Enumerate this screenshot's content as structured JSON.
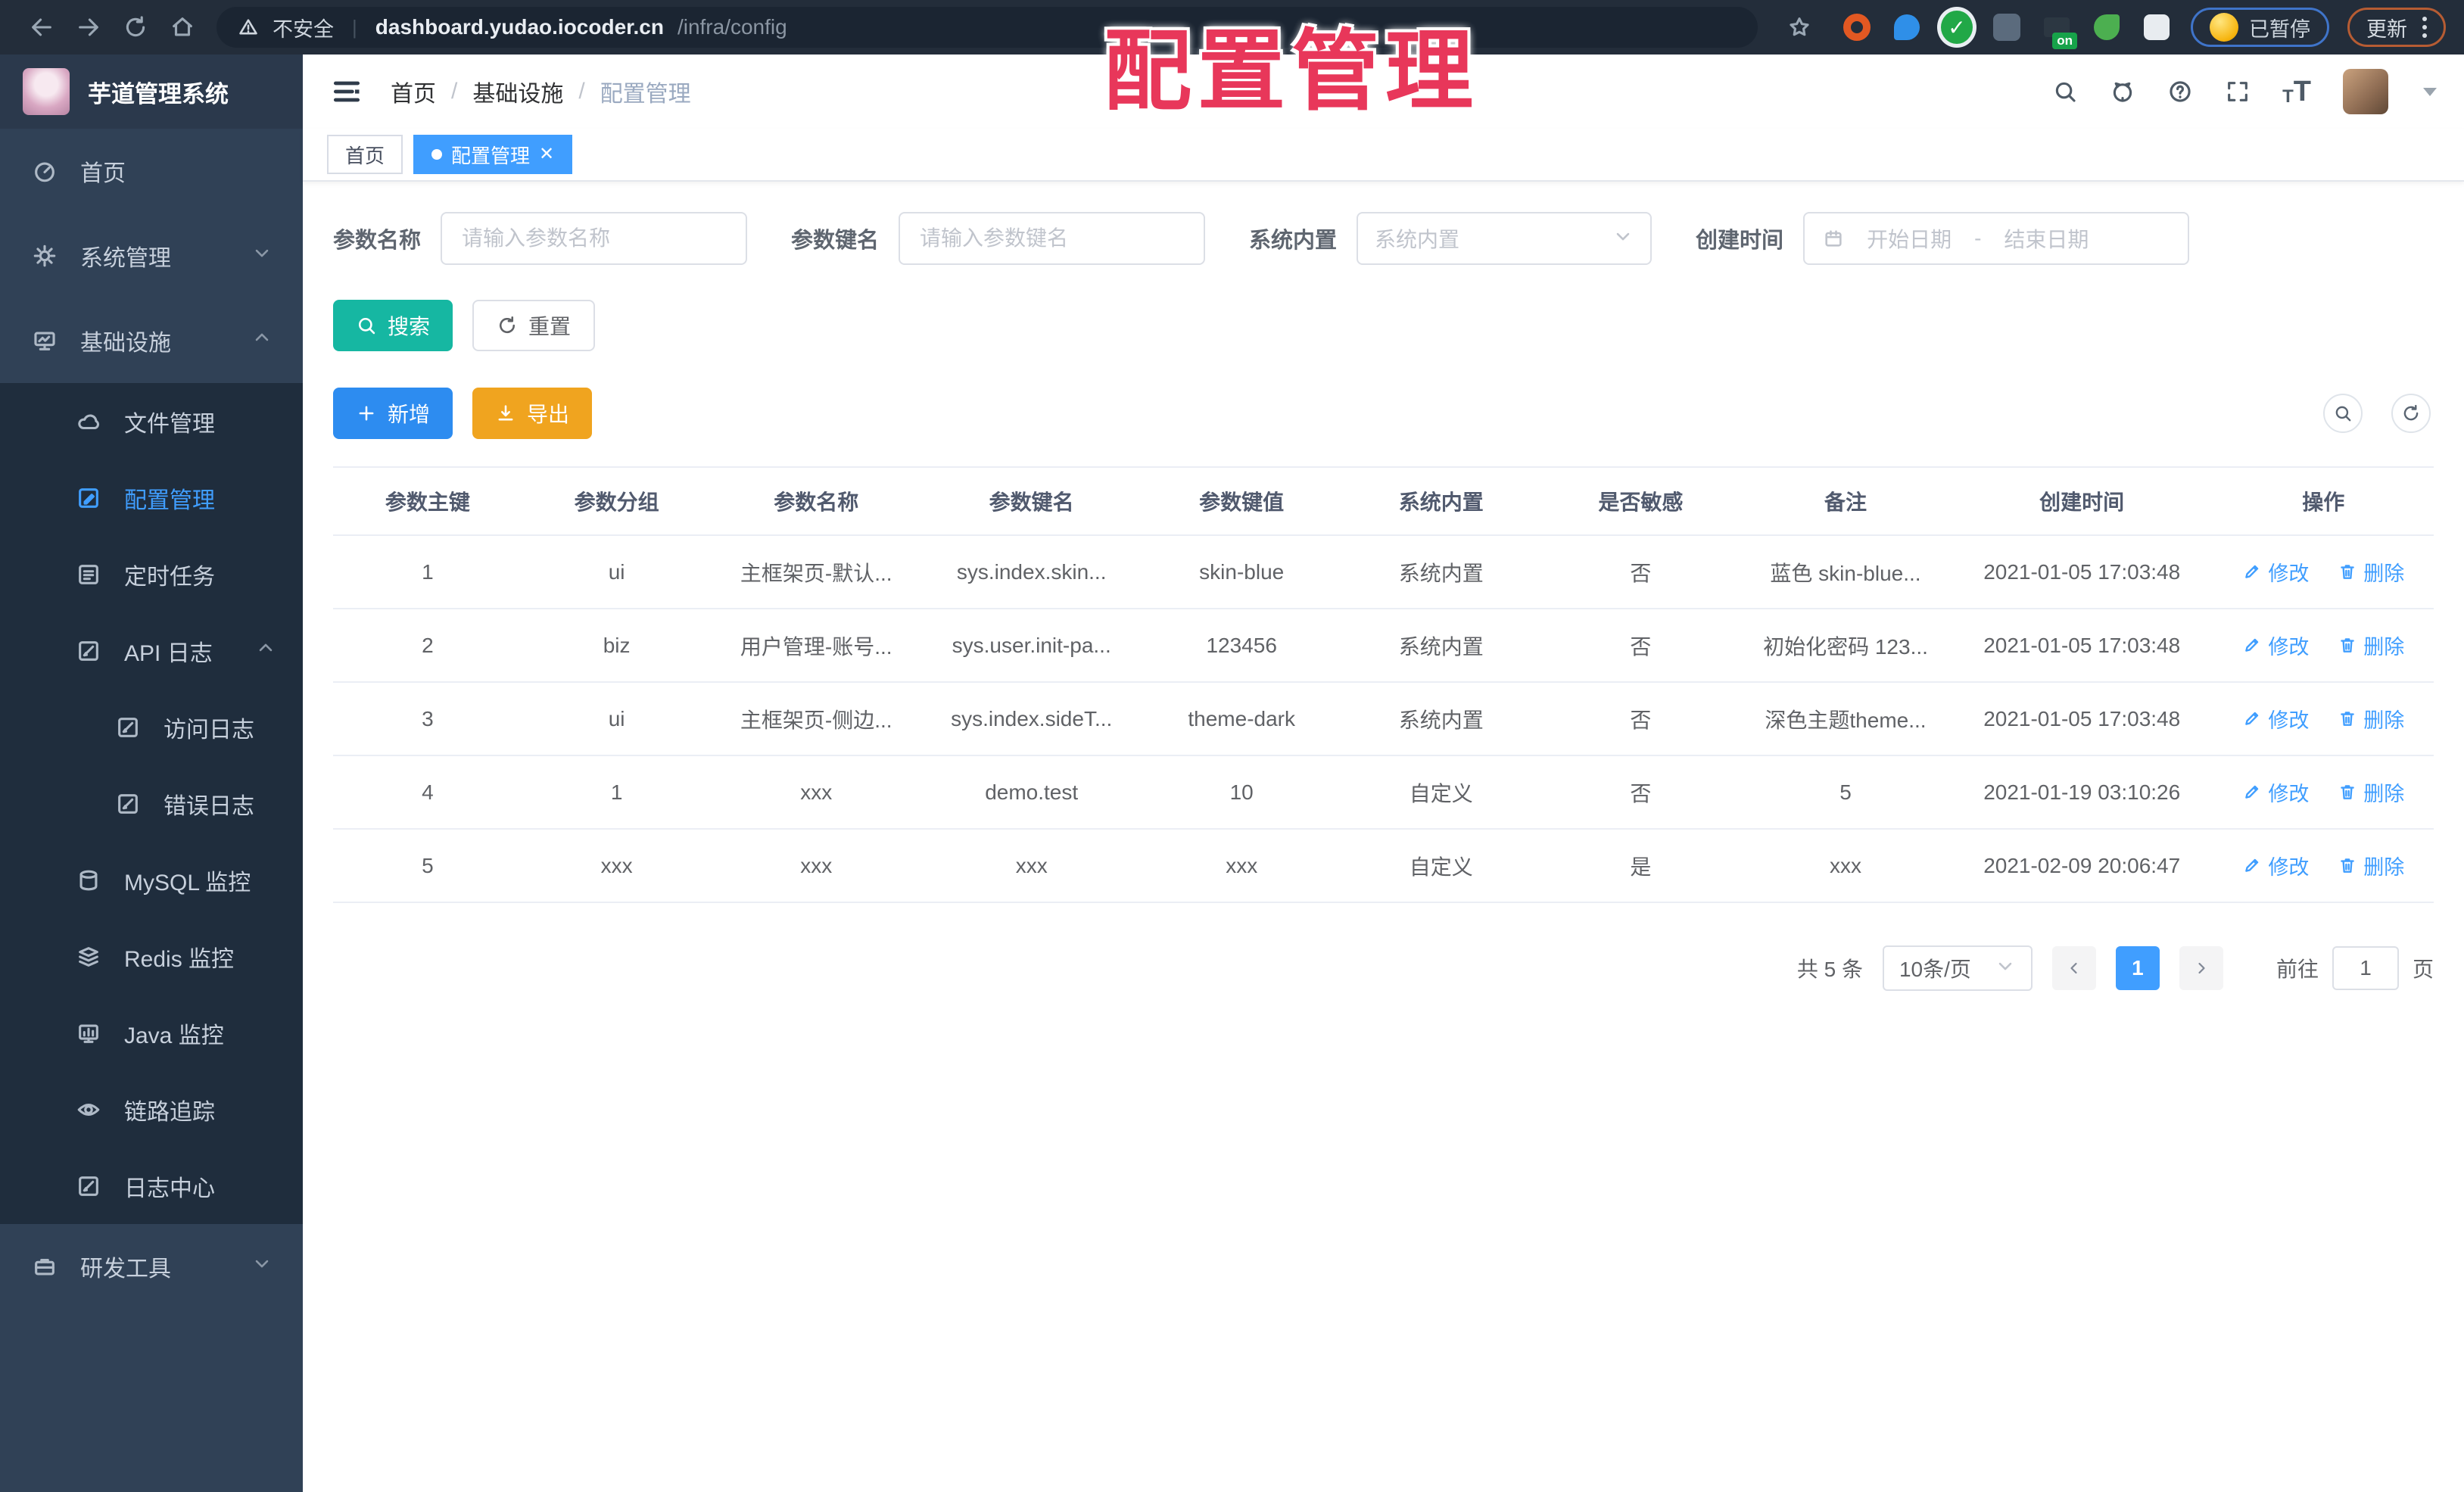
{
  "browser": {
    "security_label": "不安全",
    "url_host": "dashboard.yudao.iocoder.cn",
    "url_path": "/infra/config",
    "ext_on_label": "on",
    "paused_label": "已暂停",
    "update_label": "更新"
  },
  "overlay_title": "配置管理",
  "sidebar": {
    "logo_title": "芋道管理系统",
    "items": [
      {
        "label": "首页"
      },
      {
        "label": "系统管理"
      },
      {
        "label": "基础设施"
      },
      {
        "label": "文件管理"
      },
      {
        "label": "配置管理"
      },
      {
        "label": "定时任务"
      },
      {
        "label": "API 日志"
      },
      {
        "label": "访问日志"
      },
      {
        "label": "错误日志"
      },
      {
        "label": "MySQL 监控"
      },
      {
        "label": "Redis 监控"
      },
      {
        "label": "Java 监控"
      },
      {
        "label": "链路追踪"
      },
      {
        "label": "日志中心"
      },
      {
        "label": "研发工具"
      }
    ]
  },
  "breadcrumb": {
    "items": [
      "首页",
      "基础设施",
      "配置管理"
    ],
    "separator": "/"
  },
  "tabs": [
    {
      "label": "首页"
    },
    {
      "label": "配置管理"
    }
  ],
  "filters": {
    "name_label": "参数名称",
    "name_placeholder": "请输入参数名称",
    "key_label": "参数键名",
    "key_placeholder": "请输入参数键名",
    "type_label": "系统内置",
    "type_placeholder": "系统内置",
    "time_label": "创建时间",
    "time_start": "开始日期",
    "time_separator": "-",
    "time_end": "结束日期"
  },
  "actions": {
    "search": "搜索",
    "reset": "重置",
    "add": "新增",
    "export": "导出"
  },
  "table": {
    "columns": [
      "参数主键",
      "参数分组",
      "参数名称",
      "参数键名",
      "参数键值",
      "系统内置",
      "是否敏感",
      "备注",
      "创建时间",
      "操作"
    ],
    "op_edit": "修改",
    "op_delete": "删除",
    "rows": [
      {
        "cells": [
          "1",
          "ui",
          "主框架页-默认...",
          "sys.index.skin...",
          "skin-blue",
          "系统内置",
          "否",
          "蓝色 skin-blue...",
          "2021-01-05 17:03:48"
        ]
      },
      {
        "cells": [
          "2",
          "biz",
          "用户管理-账号...",
          "sys.user.init-pa...",
          "123456",
          "系统内置",
          "否",
          "初始化密码 123...",
          "2021-01-05 17:03:48"
        ]
      },
      {
        "cells": [
          "3",
          "ui",
          "主框架页-侧边...",
          "sys.index.sideT...",
          "theme-dark",
          "系统内置",
          "否",
          "深色主题theme...",
          "2021-01-05 17:03:48"
        ]
      },
      {
        "cells": [
          "4",
          "1",
          "xxx",
          "demo.test",
          "10",
          "自定义",
          "否",
          "5",
          "2021-01-19 03:10:26"
        ]
      },
      {
        "cells": [
          "5",
          "xxx",
          "xxx",
          "xxx",
          "xxx",
          "自定义",
          "是",
          "xxx",
          "2021-02-09 20:06:47"
        ]
      }
    ]
  },
  "pagination": {
    "total": "共 5 条",
    "page_size": "10条/页",
    "current_page": "1",
    "goto_label": "前往",
    "goto_value": "1",
    "goto_suffix": "页"
  },
  "colors": {
    "accent": "#409eff",
    "search_button": "#16b7a2",
    "add_button": "#2d8cf0",
    "export_button": "#f0a41f",
    "sidebar_bg": "#304156",
    "submenu_bg": "#1f2d3d",
    "overlay_title": "#e8375a"
  }
}
